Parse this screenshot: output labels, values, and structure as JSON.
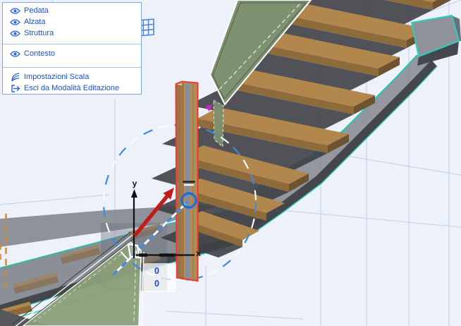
{
  "context_menu": {
    "items": [
      {
        "label": "Pedata",
        "icon": "eye-icon"
      },
      {
        "label": "Alzata",
        "icon": "eye-icon"
      },
      {
        "label": "Struttura",
        "icon": "eye-icon"
      },
      {
        "label": "Contesto",
        "icon": "eye-icon"
      },
      {
        "label": "Impostazioni Scala",
        "icon": "stair-settings-icon"
      },
      {
        "label": "Esci da Modalità Editazione",
        "icon": "exit-icon"
      }
    ],
    "text_color": "#1C53CC",
    "border_color": "#7FA8E0"
  },
  "tracker": {
    "rows": [
      {
        "value": "0"
      },
      {
        "value": "0"
      }
    ],
    "value_color": "#1E4FD0"
  },
  "scene": {
    "axis_labels": {
      "x": "x",
      "y": "y"
    },
    "icons": [
      "grid-tool-icon",
      "eye-icon",
      "stair-settings-icon",
      "exit-icon"
    ],
    "colors": {
      "background": "#EDF1FA",
      "grid_line": "#C5D3EF",
      "selection_red": "#EF3B2D",
      "highlight_teal": "#2CC3AF",
      "guide_blue": "#4287DD",
      "edit_ring_blue": "#1E6ED6",
      "drag_arrow_red": "#C11D18",
      "guide_orange": "#E8820C",
      "marker_magenta": "#C22BC2",
      "wood_top": "#B1874D",
      "wood_front": "#8F6B3B",
      "railing_green": "#7E9170",
      "stringer_gray": "#8A8D93",
      "stringer_dark": "#45474C"
    }
  }
}
